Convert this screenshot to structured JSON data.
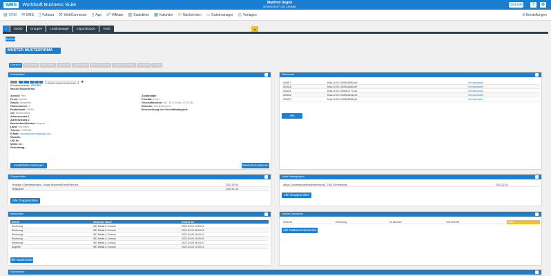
{
  "app": {
    "logo": "WBS",
    "title": "Worldsoft Business Suite",
    "user_name": "Manfred Degen",
    "user_company": "WORLDSOFT AG / ADMIN",
    "upgrade": "Upgrade",
    "help_icon": "question-icon",
    "settings_icon": "gear-icon"
  },
  "menu": [
    {
      "icon": "crm-icon",
      "label": "CRM"
    },
    {
      "icon": "email-icon",
      "label": "EMS"
    },
    {
      "icon": "invoice-icon",
      "label": "Faktura"
    },
    {
      "icon": "connector-icon",
      "label": "WebConnector"
    },
    {
      "icon": "app-icon",
      "label": "App"
    },
    {
      "icon": "affiliate-icon",
      "label": "Affiliate"
    },
    {
      "icon": "chart-icon",
      "label": "Statistiken"
    },
    {
      "icon": "calendar-icon",
      "label": "Kalender"
    },
    {
      "icon": "message-icon",
      "label": "Nachrichten"
    },
    {
      "icon": "file-icon",
      "label": "Dateimanager"
    },
    {
      "icon": "template-icon",
      "label": "Vorlagen"
    }
  ],
  "settings_label": "Einstellungen",
  "tabs": [
    "Suche",
    "Gruppen",
    "Leadmanager",
    "Import/Export",
    "Tools"
  ],
  "back_button": "Zurück",
  "company_banner": "MUSTER MUSTERFIRMA",
  "subtabs": [
    "Übersicht",
    "Kommentare",
    "Nachrichten",
    "Dokumente",
    "Bestellungen",
    "Newsletter-Status",
    "Faktura-Dokumente",
    "Aktivitäten",
    "Affiliate"
  ],
  "contact": {
    "header": "Kontaktdaten",
    "login_button": "Direktes Login in Kundenkonto",
    "customer_no": "Kundennummer: 1057954",
    "company_name": "Muster Musterfirma",
    "left": [
      [
        "Anrede:",
        "Herr"
      ],
      [
        "Firma:",
        "Muster"
      ],
      [
        "Straße:",
        "Musterstr."
      ],
      [
        "Hausnummer:",
        "1"
      ],
      [
        "Postleitzahl:",
        "00000"
      ],
      [
        "Ort:",
        "Musterstadt"
      ],
      [
        "Adresszusatz 1",
        ""
      ],
      [
        "Adresszusatz 2",
        ""
      ],
      [
        "Bundesland/Kanton:",
        "Bayern"
      ],
      [
        "Land:",
        "Germany"
      ],
      [
        "Telefon:",
        "0123456"
      ],
      [
        "E-Mail:",
        "musterkunden@gmail.com"
      ],
      [
        "Website:",
        ""
      ],
      [
        "UID-Nr:",
        ""
      ],
      [
        "MwSt. Nr.:",
        ""
      ],
      [
        "Geburtstag:",
        ""
      ]
    ],
    "right": [
      [
        "Zuständiger",
        ""
      ],
      [
        "Priorität:",
        "Hoch"
      ],
      [
        "Geschäftszeiten:",
        "Mo - Fr 8.00 bis 17.00 Uhr"
      ],
      [
        "Branche:",
        "Musterbranche"
      ],
      [
        "Beschreibung der Geschäftstätigkeit:",
        ""
      ]
    ],
    "btn_addresses": "Zusätzliche Adressen",
    "btn_bank": "Bankinformationen"
  },
  "documents": {
    "header": "Dokumente",
    "rows": [
      [
        "000017",
        "beta-10 02-1945341850.pdf",
        "Herunterladen"
      ],
      [
        "000016",
        "beta-10 02-1945341850.pdf",
        "Herunterladen"
      ],
      [
        "000021",
        "beta-10 02-1945341777.pdf",
        "Herunterladen"
      ],
      [
        "000022",
        "beta-10 02-1945341814.pdf",
        "Herunterladen"
      ],
      [
        "000027",
        "beta-10 02-1945341828.pdf",
        "Herunterladen"
      ]
    ],
    "button": "Alle Dokumente"
  },
  "groups": {
    "header": "Gruppenrollen",
    "rows": [
      [
        "Produkte / Dienstleistungen, Google Business/Event/Plaza etc",
        "2022-02-09"
      ],
      [
        "Testgruppe",
        "2022-01-18"
      ]
    ],
    "button": "Alle Gruppenrollen"
  },
  "lastgroups": {
    "header": "Letzte Antiengruppen",
    "rows": [
      [
        "Aktiva_Suchmaschinenoptimierung inkl. 2 Bis 3 8 Keywords",
        "2022-02-24"
      ]
    ],
    "button": "Alle Gruppenrollen"
  },
  "messages": {
    "header": "Nachrichten",
    "cols": [
      "Betreff",
      "Absender Name",
      "Erstellt am"
    ],
    "rows": [
      [
        "Rechnung",
        "WD Media & Consult",
        "2022-03-10 03:23:13"
      ],
      [
        "Rechnung",
        "WD Media & Consult",
        "2022-03-10 08:43:15"
      ],
      [
        "Rechnung",
        "WD Media & Consult",
        "2022-03-09 16:34:10"
      ],
      [
        "Rechnung",
        "WD Media & Consult",
        "2022-03-09 00:09:03"
      ],
      [
        "Rechnung",
        "WD Media & Consult",
        "2022-03-09 08:34:10"
      ],
      [
        "Angebot",
        "WD Media & Consult",
        "2022-03-04 23:25:11"
      ]
    ],
    "button": "Alle Nachrichten"
  },
  "faktura": {
    "header": "Faktura Dokumente",
    "rows": [
      [
        "0000167",
        "Rechnung",
        "04.08.2022",
        "344.00 EUR",
        "Offen"
      ]
    ],
    "button": "Alle Faktura Dokumente"
  },
  "comments": {
    "header": "Kommentare"
  }
}
